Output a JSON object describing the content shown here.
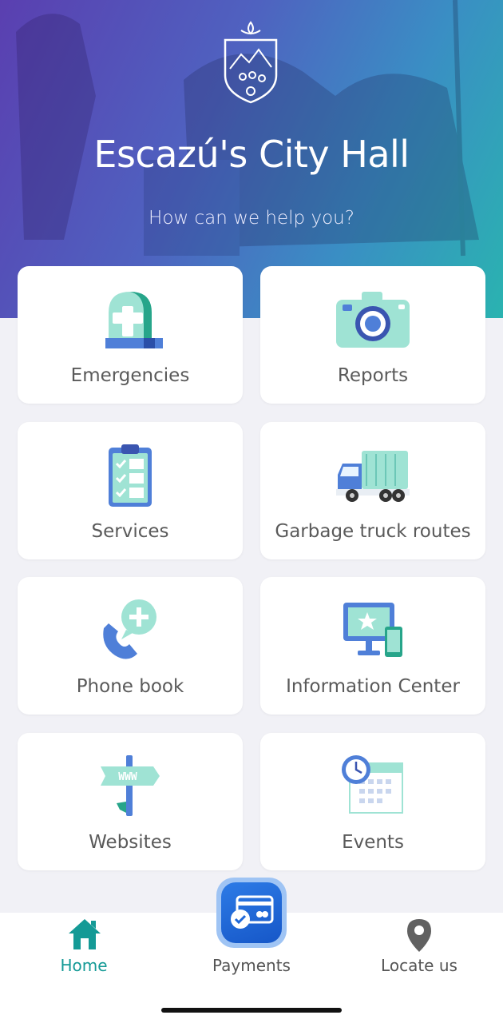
{
  "header": {
    "title": "Escazú's City Hall",
    "subtitle": "How can we help you?",
    "logo_icon": "city-crest-icon"
  },
  "grid": [
    {
      "label": "Emergencies",
      "icon": "tombstone-cross-icon"
    },
    {
      "label": "Reports",
      "icon": "camera-icon"
    },
    {
      "label": "Services",
      "icon": "clipboard-checklist-icon"
    },
    {
      "label": "Garbage truck routes",
      "icon": "garbage-truck-icon"
    },
    {
      "label": "Phone book",
      "icon": "phone-plus-icon"
    },
    {
      "label": "Information Center",
      "icon": "monitor-star-icon"
    },
    {
      "label": "Websites",
      "icon": "www-signpost-icon"
    },
    {
      "label": "Events",
      "icon": "calendar-clock-icon"
    }
  ],
  "tabbar": {
    "home": {
      "label": "Home",
      "icon": "home-icon",
      "active": true
    },
    "payments": {
      "label": "Payments",
      "icon": "payment-card-icon"
    },
    "locate": {
      "label": "Locate us",
      "icon": "location-pin-icon"
    }
  },
  "colors": {
    "accent": "#149a96",
    "mint": "#9fe3d4",
    "blue": "#4f7fd8",
    "hero_start": "#5a3fb0",
    "hero_end": "#2ab3b0"
  }
}
